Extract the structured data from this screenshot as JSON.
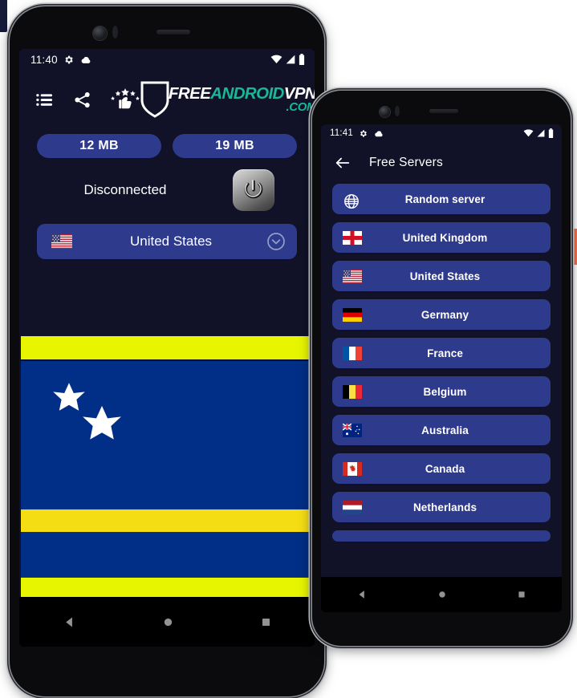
{
  "colors": {
    "screen_bg": "#111128",
    "accent_blue": "#2e3a8c",
    "logo_teal": "#19b89a",
    "flag_yellow_bright": "#e8f500",
    "flag_yellow": "#f5dd14",
    "flag_blue": "#012f87",
    "orange_strip": "#f2714e"
  },
  "phone1": {
    "status_bar": {
      "time": "11:40",
      "left_icons": [
        "settings-gear-icon",
        "cloud-icon"
      ],
      "right_icons": [
        "wifi-icon",
        "signal-icon",
        "battery-icon"
      ]
    },
    "toolbar": {
      "icons": [
        "list-menu-icon",
        "share-icon",
        "rate-us-icon"
      ]
    },
    "logo": {
      "shield": "shield-icon",
      "part1": "FREE",
      "part2": "ANDROID",
      "part3": "VPN",
      "part4": ".COM"
    },
    "data_pills": [
      {
        "name": "download-usage",
        "value": "12 MB"
      },
      {
        "name": "upload-usage",
        "value": "19 MB"
      }
    ],
    "connection": {
      "status_text": "Disconnected",
      "power_button": "power-toggle-icon"
    },
    "country_selector": {
      "flag": "us-flag-icon",
      "label": "United States",
      "chevron": "chevron-down-icon"
    },
    "banner_flag": {
      "name": "curacao-flag-banner",
      "stars": 2
    },
    "nav_bar": [
      "back-nav-icon",
      "home-nav-icon",
      "recents-nav-icon"
    ]
  },
  "phone2": {
    "status_bar": {
      "time": "11:41",
      "left_icons": [
        "settings-gear-icon",
        "cloud-icon"
      ],
      "right_icons": [
        "wifi-icon",
        "signal-icon",
        "battery-icon"
      ]
    },
    "app_bar": {
      "back": "back-arrow-icon",
      "title": "Free Servers"
    },
    "servers": [
      {
        "flag": "globe-icon",
        "name": "Random server"
      },
      {
        "flag": "england-flag-icon",
        "name": "United Kingdom"
      },
      {
        "flag": "us-flag-icon",
        "name": "United States"
      },
      {
        "flag": "germany-flag-icon",
        "name": "Germany"
      },
      {
        "flag": "france-flag-icon",
        "name": "France"
      },
      {
        "flag": "belgium-flag-icon",
        "name": "Belgium"
      },
      {
        "flag": "australia-flag-icon",
        "name": "Australia"
      },
      {
        "flag": "canada-flag-icon",
        "name": "Canada"
      },
      {
        "flag": "netherlands-flag-icon",
        "name": "Netherlands"
      }
    ],
    "nav_bar": [
      "back-nav-icon",
      "home-nav-icon",
      "recents-nav-icon"
    ]
  }
}
